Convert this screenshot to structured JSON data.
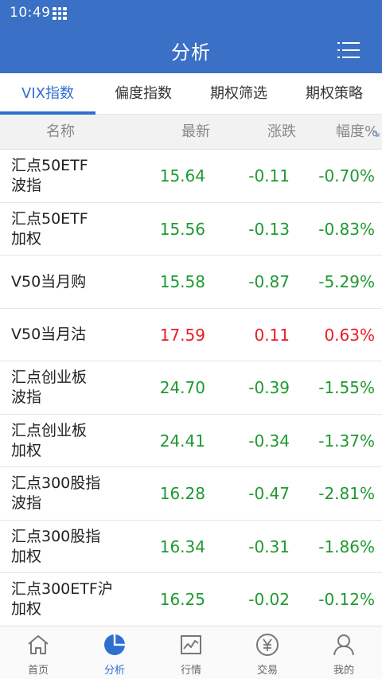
{
  "status": {
    "time": "10:49"
  },
  "header": {
    "title": "分析"
  },
  "tabs": [
    {
      "label": "VIX指数",
      "active": true
    },
    {
      "label": "偏度指数",
      "active": false
    },
    {
      "label": "期权筛选",
      "active": false
    },
    {
      "label": "期权策略",
      "active": false
    }
  ],
  "table": {
    "columns": {
      "name": "名称",
      "latest": "最新",
      "change": "涨跌",
      "pct": "幅度%"
    },
    "rows": [
      {
        "name1": "汇点50ETF",
        "name2": "波指",
        "latest": "15.64",
        "change": "-0.11",
        "pct": "-0.70%",
        "dir": "down"
      },
      {
        "name1": "汇点50ETF",
        "name2": "加权",
        "latest": "15.56",
        "change": "-0.13",
        "pct": "-0.83%",
        "dir": "down"
      },
      {
        "name1": "V50当月购",
        "name2": "",
        "latest": "15.58",
        "change": "-0.87",
        "pct": "-5.29%",
        "dir": "down"
      },
      {
        "name1": "V50当月沽",
        "name2": "",
        "latest": "17.59",
        "change": "0.11",
        "pct": "0.63%",
        "dir": "up"
      },
      {
        "name1": "汇点创业板",
        "name2": "波指",
        "latest": "24.70",
        "change": "-0.39",
        "pct": "-1.55%",
        "dir": "down"
      },
      {
        "name1": "汇点创业板",
        "name2": "加权",
        "latest": "24.41",
        "change": "-0.34",
        "pct": "-1.37%",
        "dir": "down"
      },
      {
        "name1": "汇点300股指",
        "name2": "波指",
        "latest": "16.28",
        "change": "-0.47",
        "pct": "-2.81%",
        "dir": "down"
      },
      {
        "name1": "汇点300股指",
        "name2": "加权",
        "latest": "16.34",
        "change": "-0.31",
        "pct": "-1.86%",
        "dir": "down"
      },
      {
        "name1": "汇点300ETF沪",
        "name2": "加权",
        "latest": "16.25",
        "change": "-0.02",
        "pct": "-0.12%",
        "dir": "down"
      }
    ]
  },
  "colors": {
    "brand": "#3a70c5",
    "up": "#ea1c24",
    "down": "#1e9a31",
    "active": "#2e6fd0"
  },
  "nav": [
    {
      "label": "首页",
      "icon": "home-icon",
      "active": false
    },
    {
      "label": "分析",
      "icon": "pie-chart-icon",
      "active": true
    },
    {
      "label": "行情",
      "icon": "line-chart-icon",
      "active": false
    },
    {
      "label": "交易",
      "icon": "yen-icon",
      "active": false
    },
    {
      "label": "我的",
      "icon": "user-icon",
      "active": false
    }
  ]
}
